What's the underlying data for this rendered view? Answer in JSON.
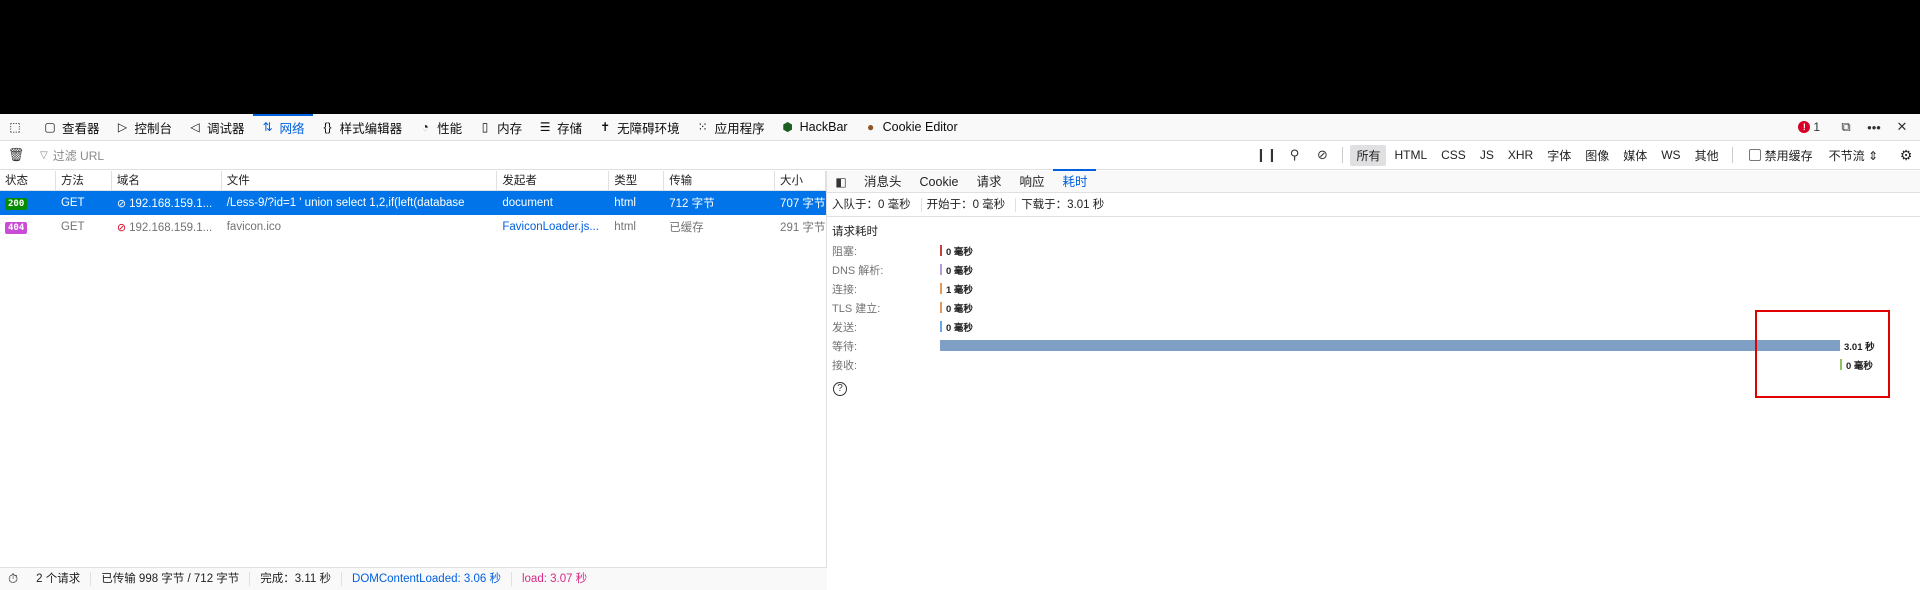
{
  "toolbox": {
    "tabs": [
      {
        "label": "查看器",
        "icon": "inspector-icon"
      },
      {
        "label": "控制台",
        "icon": "console-icon"
      },
      {
        "label": "调试器",
        "icon": "debugger-icon"
      },
      {
        "label": "网络",
        "icon": "network-icon",
        "active": true
      },
      {
        "label": "样式编辑器",
        "icon": "style-editor-icon"
      },
      {
        "label": "性能",
        "icon": "performance-icon"
      },
      {
        "label": "内存",
        "icon": "memory-icon"
      },
      {
        "label": "存储",
        "icon": "storage-icon"
      },
      {
        "label": "无障碍环境",
        "icon": "accessibility-icon"
      },
      {
        "label": "应用程序",
        "icon": "application-icon"
      },
      {
        "label": "HackBar",
        "icon": "hackbar-icon"
      },
      {
        "label": "Cookie Editor",
        "icon": "cookie-icon"
      }
    ],
    "error_count": "1"
  },
  "filter": {
    "placeholder": "过滤 URL",
    "types": [
      "所有",
      "HTML",
      "CSS",
      "JS",
      "XHR",
      "字体",
      "图像",
      "媒体",
      "WS",
      "其他"
    ],
    "disable_cache_label": "禁用缓存",
    "throttle_label": "不节流 ⇕"
  },
  "table": {
    "headers": [
      "状态",
      "方法",
      "域名",
      "文件",
      "发起者",
      "类型",
      "传输",
      "大小"
    ],
    "rows": [
      {
        "status": "200",
        "method": "GET",
        "domain": "192.168.159.1...",
        "file": "/Less-9/?id=1 ' union select 1,2,if(left(database",
        "initiator": "document",
        "type": "html",
        "transferred": "712 字节",
        "size": "707 字节"
      },
      {
        "status": "404",
        "method": "GET",
        "domain": "192.168.159.1...",
        "file": "favicon.ico",
        "initiator": "FaviconLoader.js...",
        "type": "html",
        "transferred": "已缓存",
        "size": "291 字节"
      }
    ]
  },
  "summary": {
    "requests": "2 个请求",
    "transferred": "已传输 998 字节 / 712 字节",
    "finish": "完成：3.11 秒",
    "dcl": "DOMContentLoaded: 3.06 秒",
    "load": "load: 3.07 秒"
  },
  "sidebar": {
    "tabs": [
      "消息头",
      "Cookie",
      "请求",
      "响应",
      "耗时"
    ],
    "timing_summary": [
      "入队于：0 毫秒",
      "开始于：0 毫秒",
      "下载于：3.01 秒"
    ],
    "section_title": "请求耗时",
    "timings": [
      {
        "label": "阻塞:",
        "value": "0 毫秒",
        "color": "#c63f3f",
        "fraction": 0.0
      },
      {
        "label": "DNS 解析:",
        "value": "0 毫秒",
        "color": "#b99bd6",
        "fraction": 0.0
      },
      {
        "label": "连接:",
        "value": "1 毫秒",
        "color": "#e09a5e",
        "fraction": 0.0
      },
      {
        "label": "TLS 建立:",
        "value": "0 毫秒",
        "color": "#e09a5e",
        "fraction": 0.0
      },
      {
        "label": "发送:",
        "value": "0 毫秒",
        "color": "#6aa6e8",
        "fraction": 0.0
      },
      {
        "label": "等待:",
        "value": "3.01 秒",
        "color": "#7fa0c4",
        "fraction": 1.0
      },
      {
        "label": "接收:",
        "value": "0 毫秒",
        "color": "#8ec45f",
        "fraction": 1.0
      }
    ]
  }
}
